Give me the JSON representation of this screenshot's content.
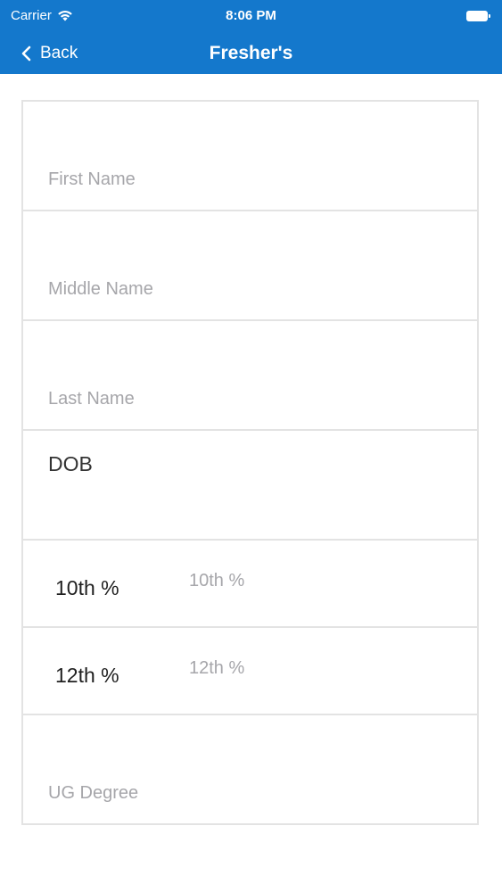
{
  "status_bar": {
    "carrier": "Carrier",
    "time": "8:06 PM",
    "wifi_icon": "wifi-icon",
    "battery_icon": "battery-icon"
  },
  "nav": {
    "back_label": "Back",
    "title": "Fresher's",
    "back_icon": "chevron-left-icon",
    "bar_color": "#1478cc"
  },
  "form": {
    "first_name": {
      "placeholder": "First Name",
      "value": ""
    },
    "middle_name": {
      "placeholder": "Middle Name",
      "value": ""
    },
    "last_name": {
      "placeholder": "Last Name",
      "value": ""
    },
    "dob": {
      "label": "DOB"
    },
    "tenth": {
      "label": "10th %",
      "placeholder": "10th %"
    },
    "twelfth": {
      "label": "12th %",
      "placeholder": "12th %"
    },
    "ug_degree": {
      "placeholder": "UG Degree",
      "value": ""
    }
  }
}
